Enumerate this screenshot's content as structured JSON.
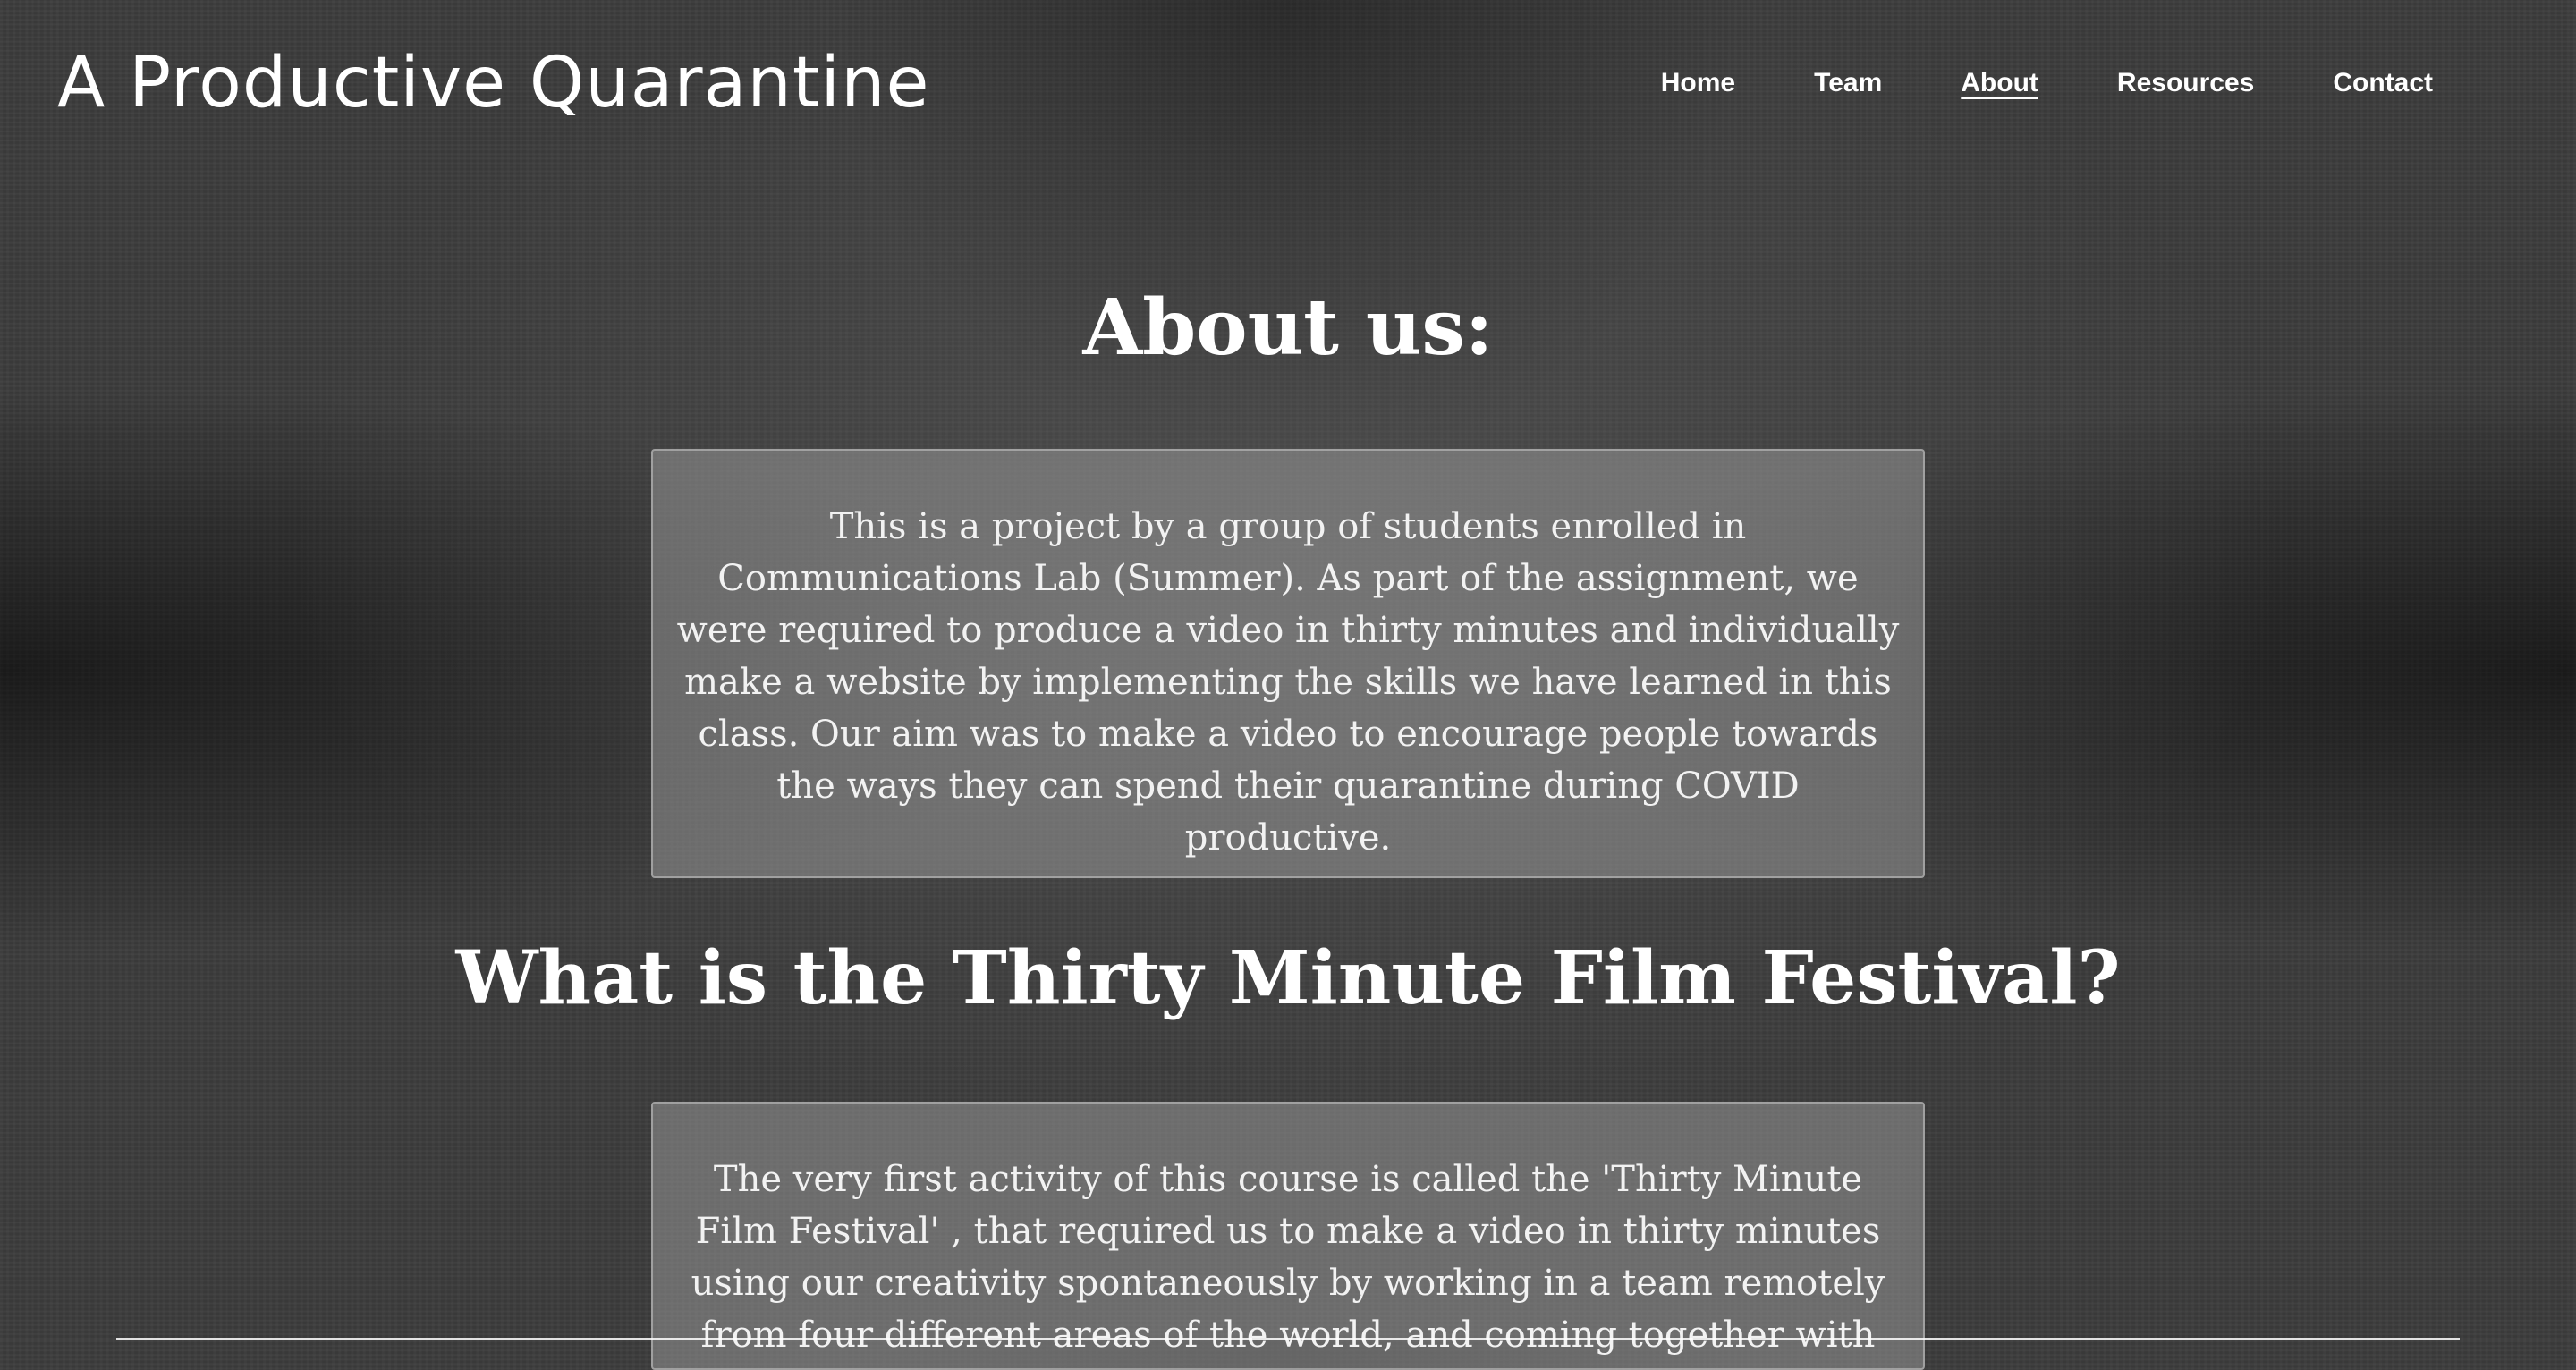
{
  "site": {
    "title": "A Productive Quarantine"
  },
  "nav": {
    "items": [
      {
        "label": "Home"
      },
      {
        "label": "Team"
      },
      {
        "label": "About"
      },
      {
        "label": "Resources"
      },
      {
        "label": "Contact"
      }
    ],
    "active": "About"
  },
  "about": {
    "heading": "About us:",
    "body": "This is a project by a group of students enrolled in Communications Lab (Summer). As part of the assignment, we were required to produce a video in thirty minutes and individually make a website by implementing the skills we have learned in this class. Our aim was to make a video to encourage people towards the ways they can spend their quarantine during COVID productive."
  },
  "festival": {
    "heading": "What is the Thirty Minute Film Festival?",
    "body": "The very first activity of this course is called the 'Thirty Minute Film Festival' , that required us to make a video in thirty minutes using our creativity spontaneously by working in a team remotely from four different areas of the world, and coming together with content that"
  }
}
